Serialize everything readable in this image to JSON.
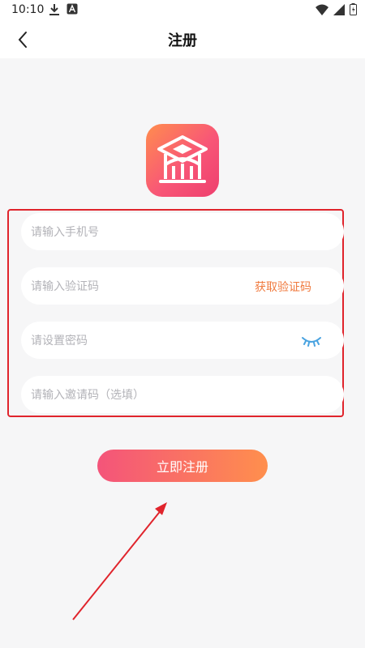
{
  "status_bar": {
    "time": "10:10",
    "icons": [
      "download-icon",
      "notification-a-icon",
      "wifi-icon",
      "signal-icon",
      "battery-icon"
    ]
  },
  "header": {
    "title": "注册",
    "back_icon": "chevron-left-icon"
  },
  "logo": {
    "icon": "graduation-cap-icon",
    "gradient": [
      "#ff8d4e",
      "#ee3f6e"
    ]
  },
  "form": {
    "phone": {
      "placeholder": "请输入手机号",
      "value": ""
    },
    "code": {
      "placeholder": "请输入验证码",
      "value": "",
      "action_label": "获取验证码"
    },
    "password": {
      "placeholder": "请设置密码",
      "value": "",
      "toggle_icon": "eye-closed-icon"
    },
    "invite": {
      "placeholder": "请输入邀请码（选填）",
      "value": ""
    }
  },
  "submit": {
    "label": "立即注册",
    "gradient": [
      "#f4547a",
      "#ff8f4d"
    ]
  },
  "colors": {
    "accent": "#f07a3e",
    "highlight_border": "#e0242c",
    "eye_icon": "#4aa3e0"
  }
}
